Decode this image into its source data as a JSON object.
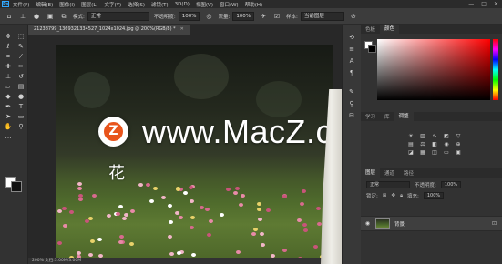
{
  "menubar": {
    "items": [
      "文件(F)",
      "编辑(E)",
      "图像(I)",
      "图层(L)",
      "文字(Y)",
      "选择(S)",
      "滤镜(T)",
      "3D(D)",
      "视图(V)",
      "窗口(W)",
      "帮助(H)"
    ],
    "logo": "Ps",
    "window_controls": [
      "—",
      "□",
      "✕"
    ]
  },
  "options": {
    "mode_label": "模式:",
    "mode_value": "正常",
    "opacity_label": "不透明度:",
    "opacity_value": "100%",
    "flow_label": "流量:",
    "flow_value": "100%",
    "sample_label": "样本:",
    "sample_value": "当前图层"
  },
  "document": {
    "tab_title": "21238799_1369321334527_1024x1024.jpg @ 200%(RGB/8) *",
    "close": "✕",
    "status": "200%  文档:3.00M/3.00M"
  },
  "watermark": {
    "logo_letter": "Z",
    "text": "www.MacZ.com",
    "glyph": "花"
  },
  "panels": {
    "color_tabs": [
      "色板",
      "颜色"
    ],
    "adjust_tabs": [
      "学习",
      "库",
      "调整"
    ],
    "layer_tabs": [
      "图层",
      "通道",
      "路径"
    ],
    "blend_mode": "正常",
    "opacity_label": "不透明度:",
    "opacity_value": "100%",
    "lock_label": "锁定:",
    "fill_label": "填充:",
    "fill_value": "100%",
    "layer_name": "背景"
  },
  "colors": {
    "accent": "#31a8ff",
    "watermark_logo": "#e8541c",
    "foreground": "#ffffff",
    "background": "#000000"
  },
  "icons": {
    "tools": [
      "move-icon",
      "marquee-icon",
      "lasso-icon",
      "quick-select-icon",
      "crop-icon",
      "eyedropper-icon",
      "healing-icon",
      "brush-icon",
      "stamp-icon",
      "history-brush-icon",
      "eraser-icon",
      "gradient-icon",
      "blur-icon",
      "dodge-icon",
      "pen-icon",
      "type-icon",
      "path-select-icon",
      "shape-icon",
      "hand-icon",
      "zoom-icon",
      "more-icon"
    ]
  }
}
